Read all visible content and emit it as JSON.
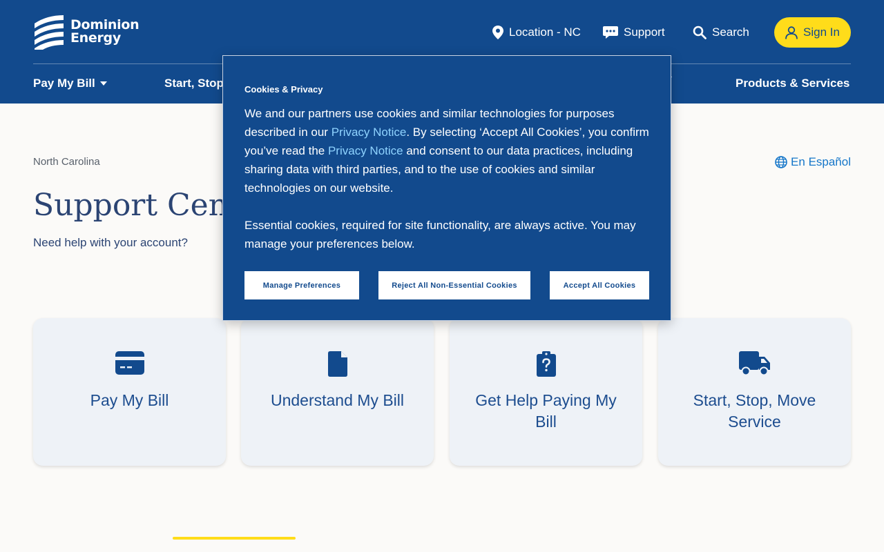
{
  "header": {
    "logo": {
      "line1": "Dominion",
      "line2": "Energy"
    },
    "utility": {
      "location": "Location - NC",
      "support": "Support",
      "search": "Search",
      "sign_in": "Sign In"
    },
    "nav": [
      {
        "label": "Pay My Bill"
      },
      {
        "label": "Start, Stop"
      },
      {
        "label": "Products & Services"
      }
    ]
  },
  "main": {
    "breadcrumb": "North Carolina",
    "language_link": "En Español",
    "title": "Support Cen",
    "subtitle": "Need help with your account?",
    "cards": [
      {
        "label": "Pay My Bill",
        "icon": "credit-card-icon"
      },
      {
        "label": "Understand My Bill",
        "icon": "document-icon"
      },
      {
        "label": "Get Help Paying My Bill",
        "icon": "clipboard-question-icon"
      },
      {
        "label": "Start, Stop, Move Service",
        "icon": "truck-icon"
      }
    ]
  },
  "cookie_dialog": {
    "title": "Cookies & Privacy",
    "p1_a": "We and our partners use cookies and similar technologies for purposes described in our ",
    "link1": "Privacy Notice",
    "p1_b": ". By selecting ‘Accept All Cookies’, you confirm you’ve read the ",
    "link2": "Privacy Notice",
    "p1_c": " and consent to our data practices, including sharing data with third parties, and to the use of cookies and similar technologies on our website.",
    "p2": "Essential cookies, required for site functionality, are always active. You may manage your preferences below.",
    "buttons": {
      "manage": "Manage Preferences",
      "reject": "Reject All Non-Essential Cookies",
      "accept": "Accept All Cookies"
    }
  },
  "colors": {
    "brand_blue": "#124a8d",
    "accent_yellow": "#ffdc1a",
    "link_light_blue": "#8fd3ff",
    "card_bg": "#eef2f7"
  }
}
